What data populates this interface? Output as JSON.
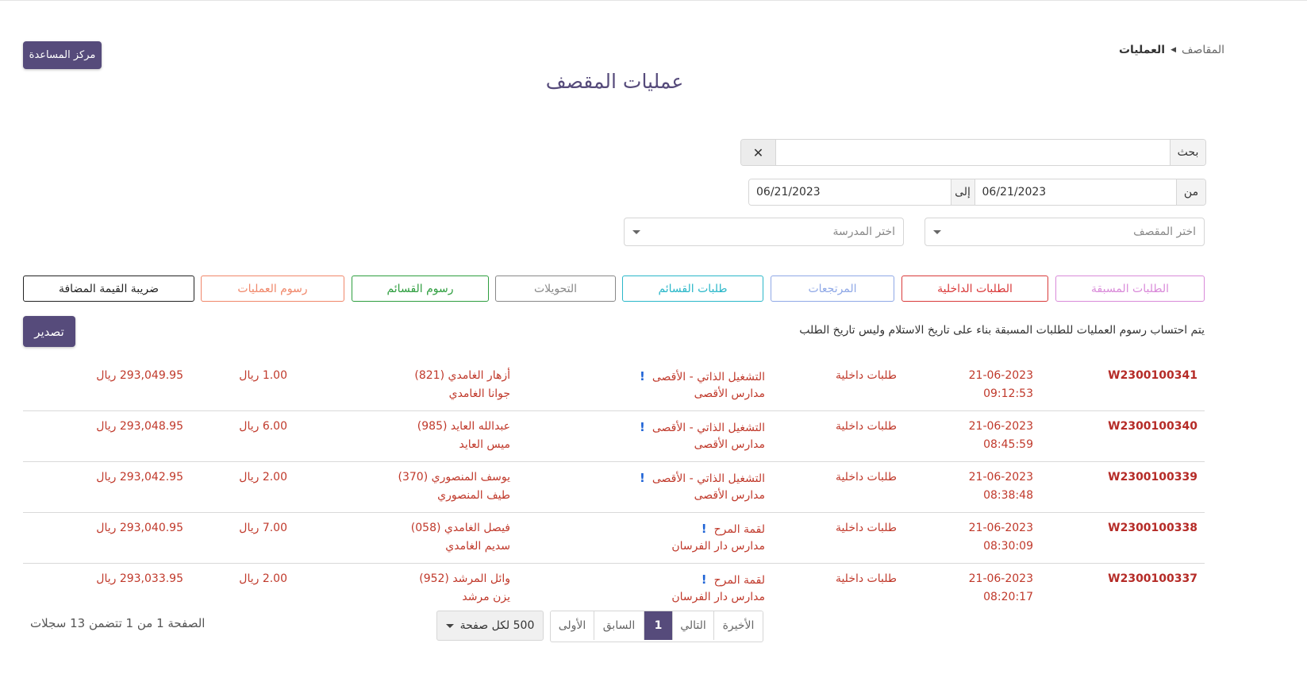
{
  "help_button": "مركز المساعدة",
  "breadcrumb": {
    "root": "المقاصف",
    "current": "العمليات"
  },
  "page_title": "عمليات المقصف",
  "search": {
    "label": "بحث",
    "value": "",
    "clear_icon": "✕"
  },
  "date_range": {
    "from_label": "من",
    "from_value": "06/21/2023",
    "to_label": "إلى",
    "to_value": "06/21/2023"
  },
  "filters": {
    "canteen_placeholder": "اختر المقصف",
    "school_placeholder": "اختر المدرسة"
  },
  "tabs": [
    {
      "label": "الطلبات المسبقة",
      "color": "#d98ad9"
    },
    {
      "label": "الطلبات الداخلية",
      "color": "#d93a3a"
    },
    {
      "label": "المرتجعات",
      "color": "#8fa8e6"
    },
    {
      "label": "طلبات القسائم",
      "color": "#2ab7c9"
    },
    {
      "label": "التحويلات",
      "color": "#888888"
    },
    {
      "label": "رسوم القسائم",
      "color": "#2e9e3f"
    },
    {
      "label": "رسوم العمليات",
      "color": "#f0876a"
    },
    {
      "label": "ضريبة القيمة المضافة",
      "color": "#222222"
    }
  ],
  "export_button": "تصدير",
  "notice": "يتم احتساب رسوم العمليات للطلبات المسبقة بناء على تاريخ الاستلام وليس تاريخ الطلب",
  "rows": [
    {
      "id": "W2300100341",
      "date": "21-06-2023",
      "time": "09:12:53",
      "type": "طلبات داخلية",
      "canteen": "التشغيل الذاتي - الأقصى",
      "school": "مدارس الأقصى",
      "person": "أزهار الغامدي (821)",
      "student": "جوانا الغامدي",
      "fee": "1.00 ريال",
      "balance": "293,049.95 ريال"
    },
    {
      "id": "W2300100340",
      "date": "21-06-2023",
      "time": "08:45:59",
      "type": "طلبات داخلية",
      "canteen": "التشغيل الذاتي - الأقصى",
      "school": "مدارس الأقصى",
      "person": "عبدالله العايد (985)",
      "student": "ميس العايد",
      "fee": "6.00 ريال",
      "balance": "293,048.95 ريال"
    },
    {
      "id": "W2300100339",
      "date": "21-06-2023",
      "time": "08:38:48",
      "type": "طلبات داخلية",
      "canteen": "التشغيل الذاتي - الأقصى",
      "school": "مدارس الأقصى",
      "person": "يوسف المنصوري (370)",
      "student": "طيف المنصوري",
      "fee": "2.00 ريال",
      "balance": "293,042.95 ريال"
    },
    {
      "id": "W2300100338",
      "date": "21-06-2023",
      "time": "08:30:09",
      "type": "طلبات داخلية",
      "canteen": "لقمة المرح",
      "school": "مدارس دار الفرسان",
      "person": "فيصل الغامدي (058)",
      "student": "سديم الغامدي",
      "fee": "7.00 ريال",
      "balance": "293,040.95 ريال"
    },
    {
      "id": "W2300100337",
      "date": "21-06-2023",
      "time": "08:20:17",
      "type": "طلبات داخلية",
      "canteen": "لقمة المرح",
      "school": "مدارس دار الفرسان",
      "person": "وائل المرشد (952)",
      "student": "يزن مرشد",
      "fee": "2.00 ريال",
      "balance": "293,033.95 ريال"
    }
  ],
  "alert_icon": "!",
  "pagination": {
    "per_page": "500 لكل صفحة",
    "first": "الأولى",
    "prev": "السابق",
    "current": "1",
    "next": "التالي",
    "last": "الأخيرة",
    "info": "الصفحة 1 من 1 تتضمن 13 سجلات"
  }
}
